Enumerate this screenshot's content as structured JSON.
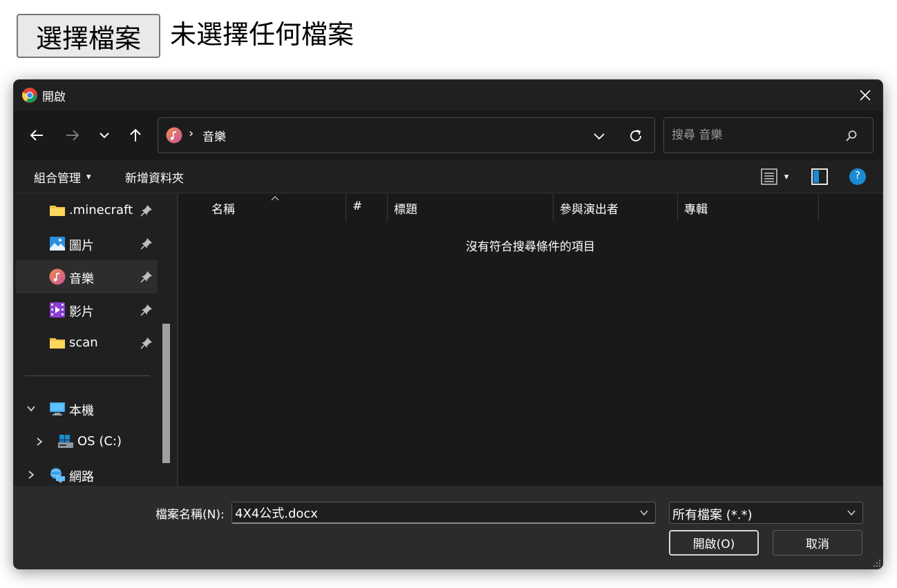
{
  "page": {
    "choose_button_label": "選擇檔案",
    "no_file_text": "未選擇任何檔案"
  },
  "dialog": {
    "title": "開啟",
    "nav": {
      "address_location": "音樂",
      "address_separator": "›",
      "search_placeholder": "搜尋 音樂"
    },
    "toolbar": {
      "organize_label": "組合管理",
      "organize_caret": "▾",
      "new_folder_label": "新增資料夾",
      "view_caret": "▾",
      "help_label": "?"
    },
    "sidebar": {
      "items": [
        {
          "label": ".minecraft",
          "icon": "folder-icon",
          "pinned": true
        },
        {
          "label": "圖片",
          "icon": "pictures-icon",
          "pinned": true
        },
        {
          "label": "音樂",
          "icon": "music-icon",
          "pinned": true,
          "selected": true
        },
        {
          "label": "影片",
          "icon": "videos-icon",
          "pinned": true
        },
        {
          "label": "scan",
          "icon": "folder-icon",
          "pinned": true
        }
      ],
      "tree": [
        {
          "label": "本機",
          "icon": "this-pc-icon",
          "expanded": true
        },
        {
          "label": "OS (C:)",
          "icon": "drive-icon",
          "expanded": false
        },
        {
          "label": "網路",
          "icon": "network-icon",
          "expanded": false
        }
      ]
    },
    "columns": [
      "名稱",
      "#",
      "標題",
      "參與演出者",
      "專輯"
    ],
    "empty_message": "沒有符合搜尋條件的項目",
    "footer": {
      "filename_label": "檔案名稱(N):",
      "filename_value": "4X4公式.docx",
      "filetype_value": "所有檔案 (*.*)",
      "open_button": "開啟(O)",
      "cancel_button": "取消"
    }
  },
  "colors": {
    "dialog_bg": "#202020",
    "content_bg": "#191919",
    "footer_bg": "#2b2b2b",
    "help_blue": "#1a8ad4",
    "folder_yellow": "#f4c542",
    "music_gradient_start": "#f38b4e",
    "music_gradient_end": "#c6569a"
  }
}
